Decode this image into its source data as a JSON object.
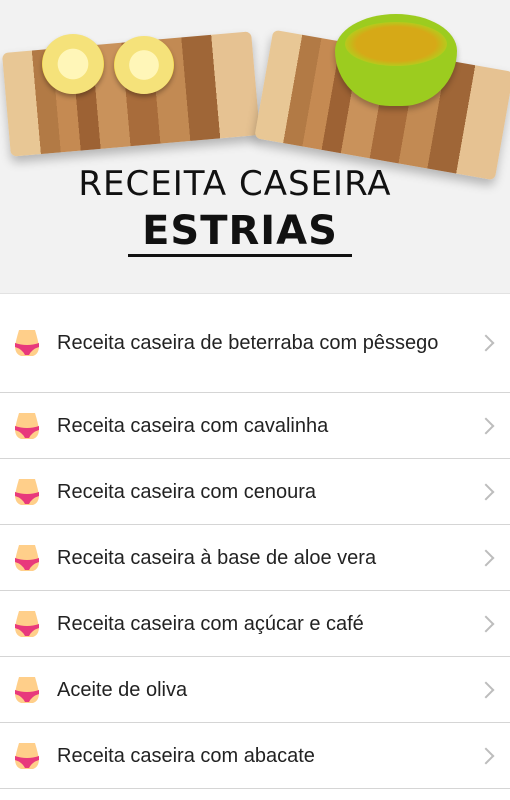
{
  "banner": {
    "title": "RECEITA CASEIRA",
    "subtitle": "ESTRIAS"
  },
  "items": [
    {
      "label": "Receita caseira de beterraba com pêssego",
      "icon": "body-icon"
    },
    {
      "label": "Receita caseira com cavalinha",
      "icon": "body-icon"
    },
    {
      "label": "Receita caseira com cenoura",
      "icon": "body-icon"
    },
    {
      "label": "Receita caseira à base de aloe vera",
      "icon": "body-icon"
    },
    {
      "label": "Receita caseira com açúcar e café",
      "icon": "body-icon"
    },
    {
      "label": "Aceite de oliva",
      "icon": "body-icon"
    },
    {
      "label": "Receita caseira com abacate",
      "icon": "body-icon"
    }
  ],
  "colors": {
    "icon_skin": "#ffcf8a",
    "icon_underwear": "#e8397c",
    "chevron": "#bdbdbd"
  }
}
